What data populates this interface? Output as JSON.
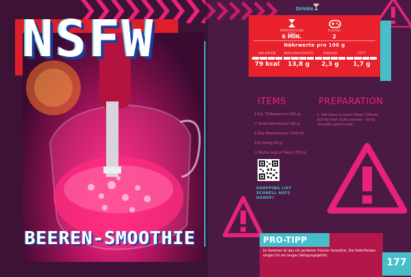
{
  "left_page": {
    "title": "NSFW",
    "subtitle": "BEEREN-SMOOTHIE"
  },
  "right_page": {
    "section_label": "Drinks",
    "info": {
      "prep_time_label": "PREPARATION TIME",
      "prep_time_value": "6 MIN.",
      "player_label": "PLAYER",
      "player_value": "2",
      "caption": "Nährwerte pro 100 g",
      "nutrition": [
        {
          "label": "KALORIEN",
          "value": "79 kcal"
        },
        {
          "label": "KOHLENHYDRATE",
          "value": "13,8 g"
        },
        {
          "label": "EIWEISS",
          "value": "2,3 g"
        },
        {
          "label": "FETT",
          "value": "1,7 g"
        }
      ]
    },
    "items_heading": "ITEMS",
    "items": [
      "1 Pck. TK-Beerenmix (300 g)",
      "½ Tasse Haferflocken (60 g)",
      "1 Glas Mineralwasser (200 ml)",
      "3 EL Honig (60 g)",
      "½ Becher Joghurt Natur (250 g)"
    ],
    "preparation_heading": "PREPARATION",
    "preparation_steps": "1. Alle Items in einem Mixer 1 Minute auf höchster Stufe pürieren – fertig. Schneller geht's nicht.",
    "qr_caption": "SHOPPING LIST SCHNELL AUFS HANDY?",
    "protip": {
      "title": "PRO-TIPP",
      "text": "Im Sommer ist das ein perfekter frischer Smoothie. Die Haferflocken sorgen für ein langes Sättigungsgefühl."
    },
    "page_number": "177"
  },
  "colors": {
    "background": "#3c1334",
    "red": "#e8212d",
    "teal": "#46bfcb",
    "pink": "#e8217a"
  },
  "icons": [
    "hourglass-icon",
    "gamepad-icon",
    "cocktail-icon",
    "warning-triangle-icon",
    "qr-code"
  ]
}
